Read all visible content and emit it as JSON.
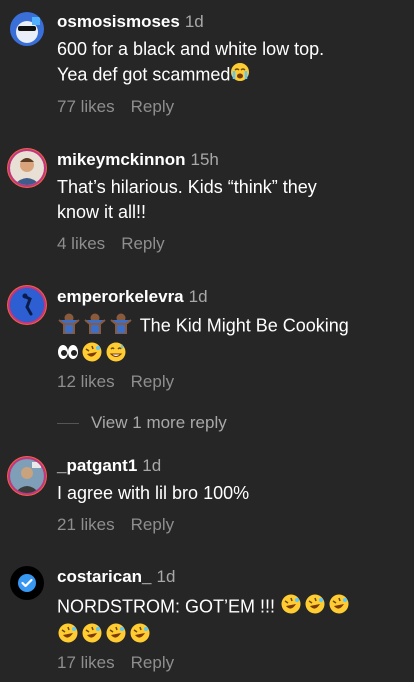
{
  "comments": [
    {
      "username": "osmosismoses",
      "time": "1d",
      "lines": [
        "600 for a black and white low top.",
        "Yea def got scammed"
      ],
      "likes": "77 likes",
      "reply": "Reply"
    },
    {
      "username": "mikeymckinnon",
      "time": "15h",
      "lines": [
        "That’s hilarious. Kids “think” they",
        "know it all!!"
      ],
      "likes": "4 likes",
      "reply": "Reply"
    },
    {
      "username": "emperorkelevra",
      "time": "1d",
      "lines": [
        "The Kid Might Be Cooking"
      ],
      "likes": "12 likes",
      "reply": "Reply"
    },
    {
      "username": "_patgant1",
      "time": "1d",
      "lines": [
        "I agree with lil bro 100%"
      ],
      "likes": "21 likes",
      "reply": "Reply"
    },
    {
      "username": "costarican_",
      "time": "1d",
      "lines": [
        "NORDSTROM:  GOT’EM !!!"
      ],
      "likes": "17 likes",
      "reply": "Reply"
    }
  ],
  "view_more": "View 1 more reply",
  "emoji_names": [
    "loudly-crying-face",
    "man-shrugging",
    "eyes",
    "rolling-on-floor-laughing",
    "grinning-sweat"
  ],
  "colors": {
    "background": "#262626",
    "secondary_text": "#8e8e8e",
    "verified_blue": "#3897f0"
  }
}
